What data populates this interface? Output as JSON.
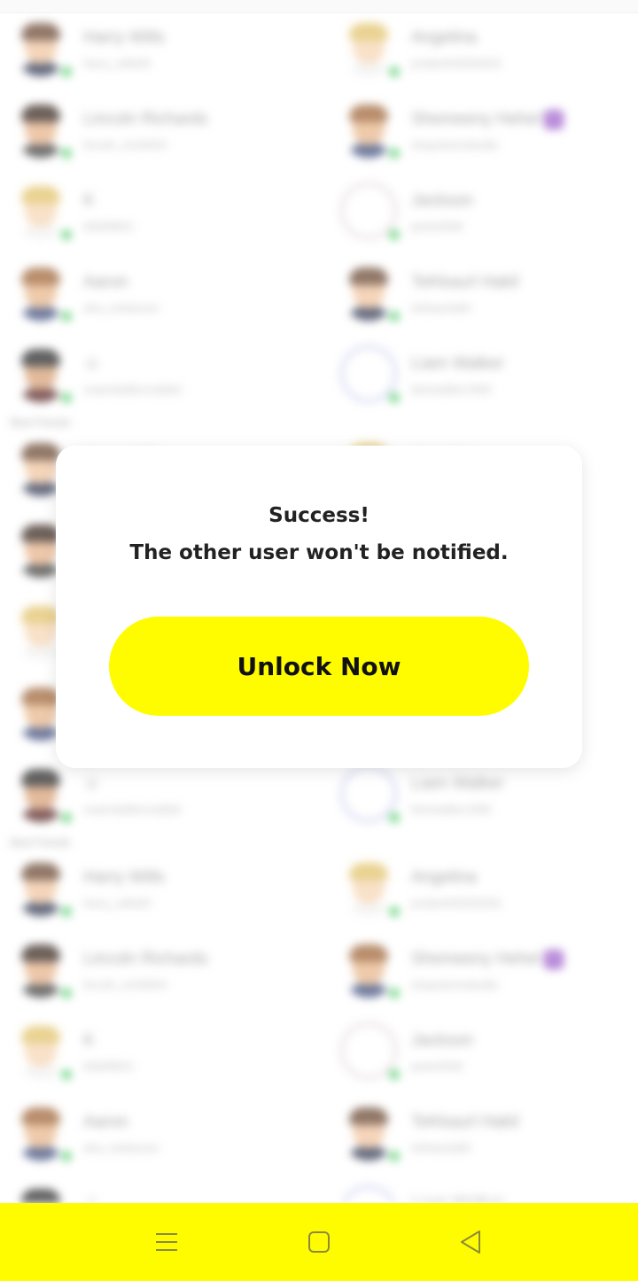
{
  "modal": {
    "title_line1": "Success!",
    "title_line2": "The other user won't be notified.",
    "unlock_label": "Unlock Now"
  },
  "colors": {
    "accent": "#fffc00",
    "online": "#3ec65a",
    "badge": "#9a58c8"
  },
  "background_list": {
    "section_label": "Best Friends",
    "rows": [
      {
        "left": {
          "name": "Harry Wills",
          "user": "harry_wills83"
        },
        "right": {
          "name": "Angelina",
          "user": "jordan033333333"
        }
      },
      {
        "left": {
          "name": "Lincoln Richards",
          "user": "lincoln_rich0004"
        },
        "right": {
          "name": "Shemeeny Hehel",
          "user": "shaystonnobudie"
        }
      },
      {
        "left": {
          "name": "K",
          "user": "k6699601"
        },
        "right": {
          "name": "Jackson",
          "user": "jacks0566"
        }
      },
      {
        "left": {
          "name": "Aaron",
          "user": "aha_melasoon"
        },
        "right": {
          "name": "TeKkaurl Hakil",
          "user": "tehkaurlabil"
        }
      },
      {
        "left": {
          "name": "☺",
          "user": "ssaerdadbscoabbd"
        },
        "right": {
          "name": "Liam Walker",
          "user": "liamwalker1994"
        }
      }
    ]
  },
  "nav": {
    "menu_icon": "menu-icon",
    "home_icon": "square-home-icon",
    "back_icon": "triangle-back-icon"
  }
}
